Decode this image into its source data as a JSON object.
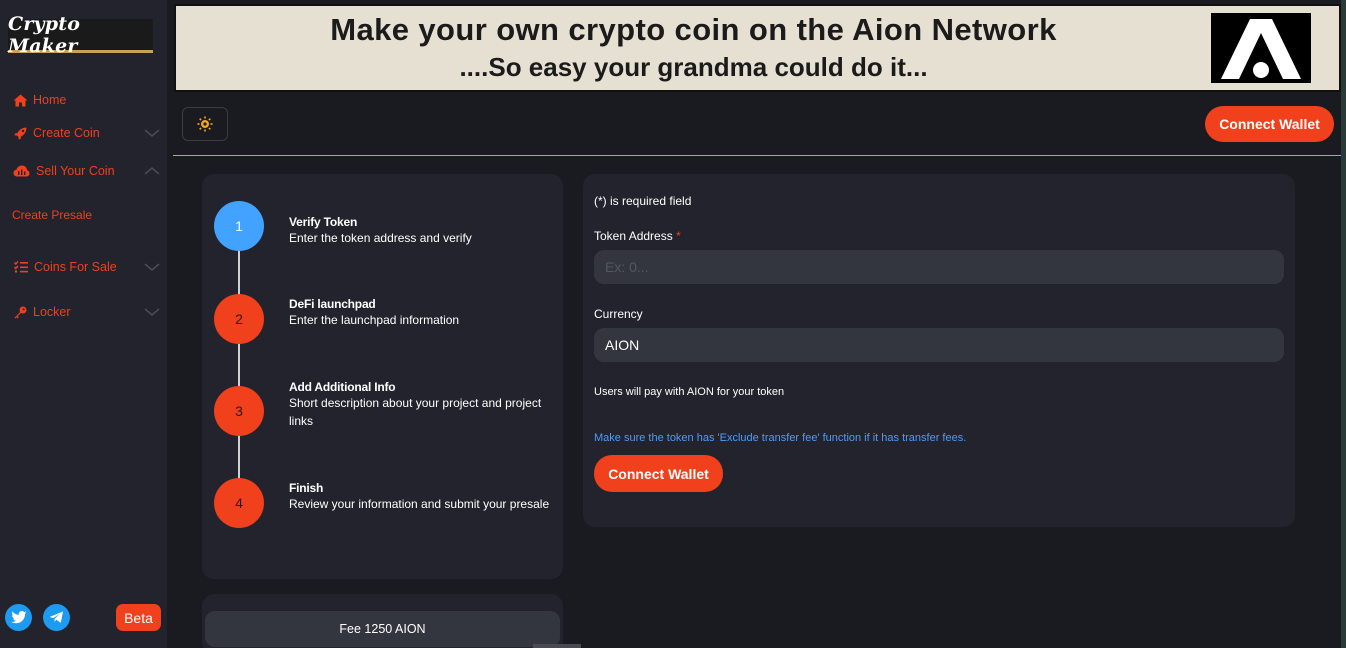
{
  "sidebar": {
    "logo_text": "Crypto Maker",
    "items": [
      {
        "label": "Home",
        "icon": "home-icon"
      },
      {
        "label": "Create Coin",
        "icon": "rocket-icon"
      },
      {
        "label": "Sell Your Coin",
        "icon": "cloud-icon"
      },
      {
        "label": "Coins For Sale",
        "icon": "list-icon"
      },
      {
        "label": "Locker",
        "icon": "key-icon"
      }
    ],
    "sub_items": [
      {
        "label": "Create Presale"
      }
    ],
    "beta_label": "Beta"
  },
  "banner": {
    "title": "Make your own crypto coin on the Aion Network",
    "subtitle": "....So easy your grandma could do it..."
  },
  "header": {
    "connect_label": "Connect Wallet"
  },
  "steps": [
    {
      "number": "1",
      "title": "Verify Token",
      "desc": "Enter the token address and verify",
      "state": "active"
    },
    {
      "number": "2",
      "title": "DeFi launchpad",
      "desc": "Enter the launchpad information",
      "state": "todo"
    },
    {
      "number": "3",
      "title": "Add Additional Info",
      "desc": "Short description about your project and project links",
      "state": "todo"
    },
    {
      "number": "4",
      "title": "Finish",
      "desc": "Review your information and submit your presale",
      "state": "todo"
    }
  ],
  "fee": {
    "label": "Fee 1250 AION"
  },
  "form": {
    "required_note": "(*) is required field",
    "token_label": "Token Address",
    "token_required": "*",
    "token_placeholder": "Ex: 0...",
    "currency_label": "Currency",
    "currency_value": "AION",
    "currency_hint": "Users will pay with AION for your token",
    "warning": "Make sure the token has 'Exclude transfer fee' function if it has transfer fees.",
    "connect_label": "Connect Wallet"
  },
  "colors": {
    "accent": "#f0401c",
    "active_step": "#42a2ff",
    "link": "#4a9dff",
    "card": "#22232c",
    "background": "#1a1b20"
  }
}
